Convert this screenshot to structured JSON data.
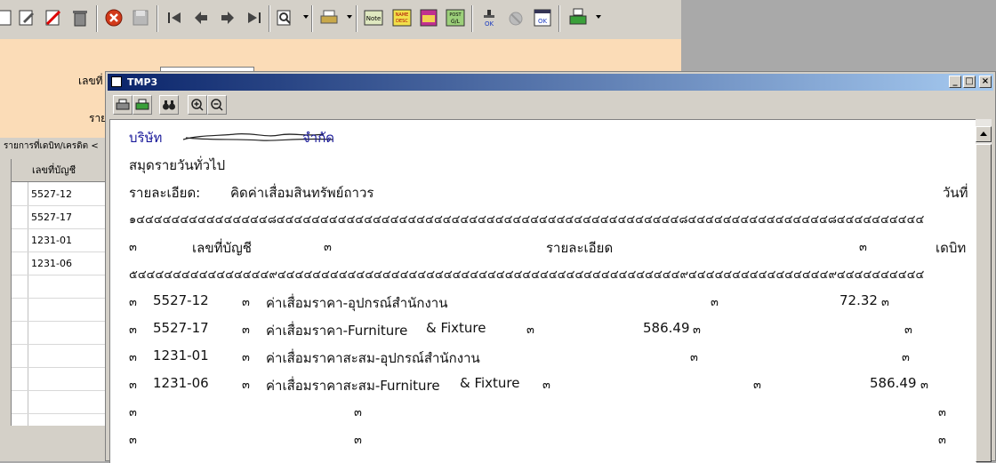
{
  "toolbar": {
    "icons": [
      "new-icon",
      "edit-icon",
      "delete-record-icon",
      "trash-icon",
      "cancel-icon",
      "save-icon",
      "first-record-icon",
      "prev-record-icon",
      "next-record-icon",
      "last-record-icon",
      "search-icon",
      "printer-icon",
      "note-icon",
      "name-desc-icon",
      "report-icon",
      "post-gl-icon",
      "ok-stamp-icon",
      "disabled-icon",
      "ok-window-icon",
      "print-preview-icon"
    ],
    "note_label": "Note",
    "name_label": "NAME",
    "desc_label": "DESC",
    "post_label": "POST",
    "gl_label": "G/L",
    "ok_label": "OK"
  },
  "background_form": {
    "label1": "เลขที่",
    "label2": "ราย",
    "grid_caption": "รายการที่เดบิท/เครดิต <",
    "column_header": "เลขที่บัญชี",
    "rows": [
      "5527-12",
      "5527-17",
      "1231-01",
      "1231-06"
    ]
  },
  "window": {
    "title": "TMP3"
  },
  "report": {
    "company_label": "บริษัท",
    "company_name_tail": "จำกัด",
    "heading": "สมุดรายวันทั่วไป",
    "detail_label": "รายละเอียด:",
    "detail_value": "คิดค่าเสื่อมสินทรัพย์ถาวร",
    "date_label": "วันที่",
    "border_top": "๑๔๔๔๔๔๔๔๔๔๔๔๔๔๔๔๘๔๔๔๔๔๔๔๔๔๔๔๔๔๔๔๔๔๔๔๔๔๔๔๔๔๔๔๔๔๔๔๔๔๔๔๔๔๔๔๔๔๔๔๔๔๔๘๔๔๔๔๔๔๔๔๔๔๔๔๔๔๔๔๘๔๔๔๔๔๔๔๔๔๔",
    "border_mid": "๕๔๔๔๔๔๔๔๔๔๔๔๔๔๔๔๙๔๔๔๔๔๔๔๔๔๔๔๔๔๔๔๔๔๔๔๔๔๔๔๔๔๔๔๔๔๔๔๔๔๔๔๔๔๔๔๔๔๔๔๔๔๔๙๔๔๔๔๔๔๔๔๔๔๔๔๔๔๔๔๙๔๔๔๔๔๔๔๔๔๔",
    "sep": "๓",
    "col_account": "เลขที่บัญชี",
    "col_detail": "รายละเอียด",
    "col_debit": "เดบิท",
    "rows": [
      {
        "account": "5527-12",
        "description": "ค่าเสื่อมราคา-อุปกรณ์สำนักงาน",
        "debit": "72.32",
        "credit": ""
      },
      {
        "account": "5527-17",
        "description": "ค่าเสื่อมราคา-Furniture",
        "description_tail": "& Fixture",
        "debit": "586.49",
        "credit": ""
      },
      {
        "account": "1231-01",
        "description": "ค่าเสื่อมราคาสะสม-อุปกรณ์สำนักงาน",
        "debit": "",
        "credit": ""
      },
      {
        "account": "1231-06",
        "description": "ค่าเสื่อมราคาสะสม-Furniture",
        "description_tail": "& Fixture",
        "debit": "",
        "credit": "586.49"
      }
    ]
  }
}
